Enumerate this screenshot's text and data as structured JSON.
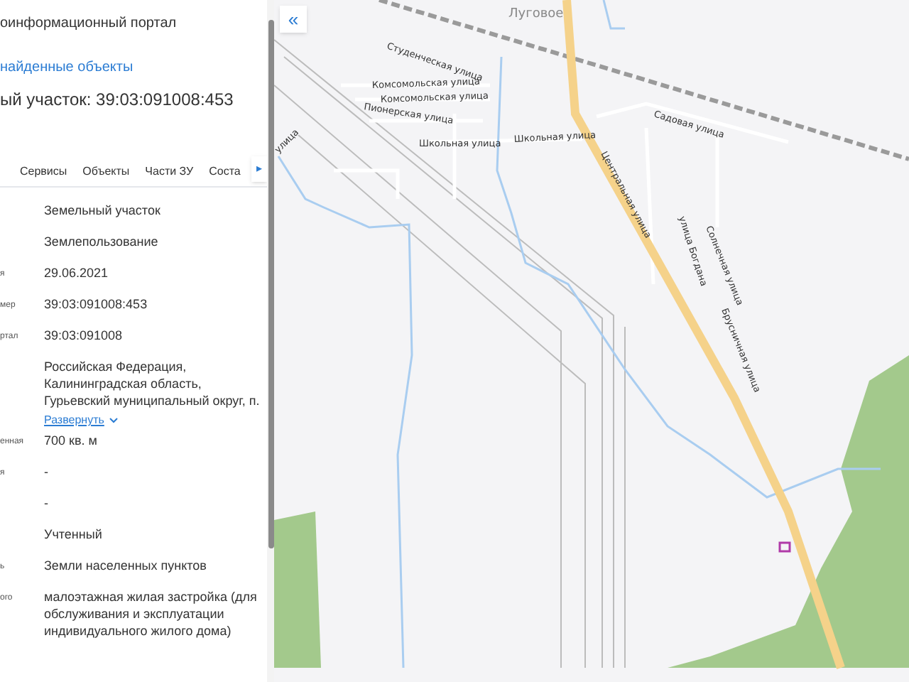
{
  "header": {
    "title": "оинформационный портал",
    "back_link": "найденные объекты",
    "heading": "ый участок: 39:03:091008:453"
  },
  "tabs": [
    {
      "label": "Сервисы",
      "selected": false
    },
    {
      "label": "Объекты",
      "selected": false
    },
    {
      "label": "Части ЗУ",
      "selected": false
    },
    {
      "label": "Соста",
      "selected": false
    }
  ],
  "tab_scroll": {
    "glyph": "▸"
  },
  "properties": [
    {
      "value": "Земельный участок"
    },
    {
      "value": "Землепользование"
    },
    {
      "label": "я",
      "value": "29.06.2021"
    },
    {
      "label": "мер",
      "value": "39:03:091008:453"
    },
    {
      "label": "ртал",
      "value": "39:03:091008"
    },
    {
      "value": "Российская Федерация, Калининградская область, Гурьевский муниципальный округ, п.",
      "expand_link": "Развернуть"
    },
    {
      "label": "енная",
      "value": "700 кв. м"
    },
    {
      "label": "я",
      "value": "-"
    },
    {
      "value": "-"
    },
    {
      "value": "Учтенный"
    },
    {
      "label": "ь",
      "value": "Земли населенных пунктов"
    },
    {
      "label": "ого",
      "value": "малоэтажная жилая застройка (для обслуживания и эксплуатации индивидуального жилого дома)"
    }
  ],
  "map": {
    "collapse_glyph": "«",
    "labels": [
      {
        "text": "Луговое",
        "kind": "place"
      },
      {
        "text": "Студенческая улица",
        "kind": "street"
      },
      {
        "text": "Комсомольская улица",
        "kind": "street"
      },
      {
        "text": "Комсомольская улица",
        "kind": "street"
      },
      {
        "text": "Пионерская улица",
        "kind": "street"
      },
      {
        "text": "улица",
        "kind": "street"
      },
      {
        "text": "Школьная улица",
        "kind": "street"
      },
      {
        "text": "Школьная улица",
        "kind": "street"
      },
      {
        "text": "Садовая улица",
        "kind": "street"
      },
      {
        "text": "Центральная улица",
        "kind": "street"
      },
      {
        "text": "улица Богдана",
        "kind": "street"
      },
      {
        "text": "Солнечная улица",
        "kind": "street"
      },
      {
        "text": "Брусничная улица",
        "kind": "street"
      }
    ]
  }
}
